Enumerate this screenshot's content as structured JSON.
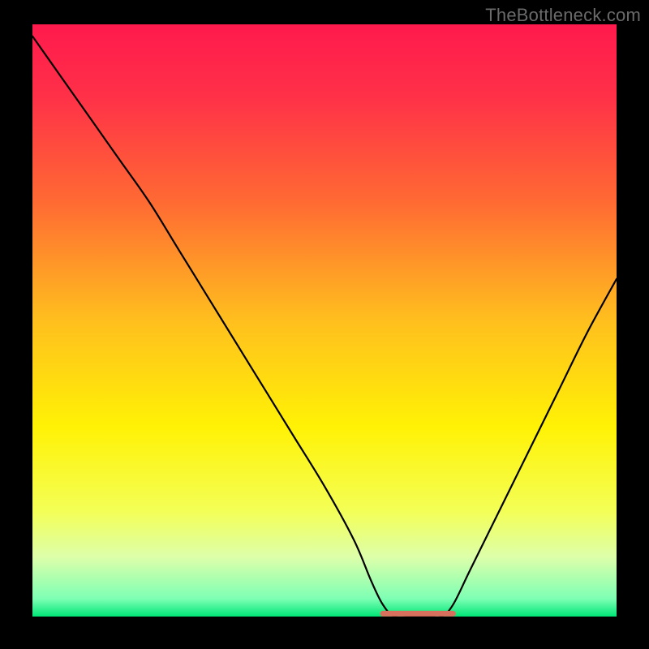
{
  "watermark": "TheBottleneck.com",
  "colors": {
    "frame": "#000000",
    "watermark": "#6a6a6a",
    "gradient_stops": [
      {
        "offset": 0.0,
        "color": "#ff1a4d"
      },
      {
        "offset": 0.12,
        "color": "#ff3048"
      },
      {
        "offset": 0.3,
        "color": "#ff6a33"
      },
      {
        "offset": 0.5,
        "color": "#ffbf1e"
      },
      {
        "offset": 0.68,
        "color": "#fff205"
      },
      {
        "offset": 0.82,
        "color": "#f4ff55"
      },
      {
        "offset": 0.9,
        "color": "#ddffaa"
      },
      {
        "offset": 0.97,
        "color": "#7dffb4"
      },
      {
        "offset": 1.0,
        "color": "#00e676"
      }
    ],
    "curve": "#000000",
    "valley_mark": "#d8705e"
  },
  "chart_data": {
    "type": "line",
    "title": "",
    "xlabel": "",
    "ylabel": "",
    "xlim": [
      0,
      100
    ],
    "ylim": [
      0,
      100
    ],
    "grid": false,
    "series": [
      {
        "name": "bottleneck-curve",
        "x": [
          0,
          5,
          10,
          15,
          20,
          25,
          30,
          35,
          40,
          45,
          50,
          55,
          58,
          60,
          62,
          65,
          68,
          70,
          72,
          75,
          80,
          85,
          90,
          95,
          100
        ],
        "y": [
          98,
          91,
          84,
          77,
          70,
          62,
          54,
          46,
          38,
          30,
          22,
          13,
          6,
          2,
          0,
          0,
          0,
          0,
          2,
          8,
          18,
          28,
          38,
          48,
          57
        ]
      }
    ],
    "annotations": [
      {
        "name": "optimal-range",
        "type": "segment",
        "x0": 60,
        "x1": 72,
        "y": 0.5
      }
    ]
  }
}
